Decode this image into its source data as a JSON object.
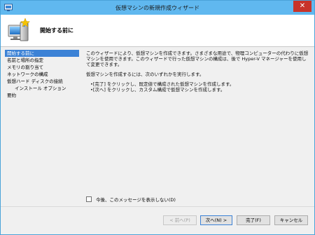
{
  "window": {
    "title": "仮想マシンの新規作成ウィザード",
    "close_glyph": "✕",
    "title_color": "#60b8ef",
    "close_color": "#c8332a"
  },
  "header": {
    "title": "開始する前に",
    "icon": "virtual-machine-icon"
  },
  "nav": {
    "items": [
      {
        "label": "開始する前に",
        "active": true
      },
      {
        "label": "名前と場所の指定"
      },
      {
        "label": "メモリの割り当て"
      },
      {
        "label": "ネットワークの構成"
      },
      {
        "label": "仮想ハード ディスクの接続"
      },
      {
        "label": "インストール オプション",
        "indent": true
      },
      {
        "label": "要約"
      }
    ],
    "active_color": "#3c82d6"
  },
  "main": {
    "para1": "このウィザードにより、仮想マシンを作成できます。さまざまな用途で、物理コンピューターの代わりに仮想マシンを使用できます。このウィザードで行った仮想マシンの構成は、後で Hyper-V マネージャーを使用して変更できます。",
    "para2": "仮想マシンを作成するには、次のいずれかを実行します。",
    "bullet1": "•[完了] をクリックし、既定値で構成された仮想マシンを作成します。",
    "bullet2": "•[次へ] をクリックし、カスタム構成で仮想マシンを作成します。"
  },
  "checkbox": {
    "label": "今後、このメッセージを表示しない(D)",
    "checked": false
  },
  "buttons": {
    "back": "< 前へ(P)",
    "next": "次へ(N) >",
    "finish": "完了(F)",
    "cancel": "キャンセル"
  }
}
